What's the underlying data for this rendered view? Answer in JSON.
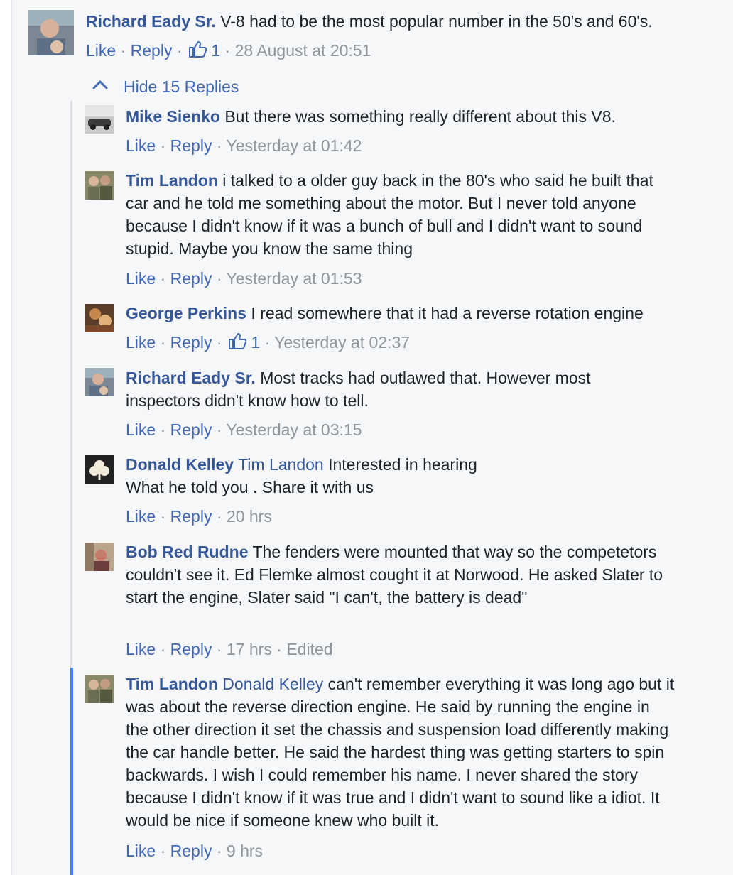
{
  "top_comment": {
    "author": "Richard Eady Sr.",
    "text": "V-8 had to be the most popular number in the 50's and 60's.",
    "like": "Like",
    "reply": "Reply",
    "likes": "1",
    "time": "28 August at 20:51"
  },
  "replies_toggle": {
    "label": "Hide 15 Replies",
    "icon": "chevron-up-icon"
  },
  "replies": [
    {
      "author": "Mike Sienko",
      "mention": "",
      "text": "But there was something really different about this V8.",
      "like": "Like",
      "reply": "Reply",
      "likes": "",
      "time": "Yesterday at 01:42",
      "edited": ""
    },
    {
      "author": "Tim Landon",
      "mention": "",
      "text": "i talked to a older guy back in the 80's who said he built that car and he told me something about the motor. But I never told anyone because I didn't know if it was a bunch of bull and I didn't want to sound stupid. Maybe you know the same thing",
      "like": "Like",
      "reply": "Reply",
      "likes": "",
      "time": "Yesterday at 01:53",
      "edited": ""
    },
    {
      "author": "George Perkins",
      "mention": "",
      "text": "I read somewhere that it had a reverse rotation engine",
      "like": "Like",
      "reply": "Reply",
      "likes": "1",
      "time": "Yesterday at 02:37",
      "edited": ""
    },
    {
      "author": "Richard Eady Sr.",
      "mention": "",
      "text": "Most tracks had outlawed that. However most inspectors didn't know how to tell.",
      "like": "Like",
      "reply": "Reply",
      "likes": "",
      "time": "Yesterday at 03:15",
      "edited": ""
    },
    {
      "author": "Donald Kelley",
      "mention": "Tim Landon",
      "text": "Interested in hearing",
      "text2": "What he told you . Share it with us",
      "like": "Like",
      "reply": "Reply",
      "likes": "",
      "time": "20 hrs",
      "edited": ""
    },
    {
      "author": "Bob Red Rudne",
      "mention": "",
      "text": "The fenders were mounted that way so the competetors couldn't see it. Ed Flemke almost cought it at Norwood. He asked Slater to start the engine, Slater said \"I can't, the battery is dead\"",
      "like": "Like",
      "reply": "Reply",
      "likes": "",
      "time": "17 hrs",
      "edited": "Edited"
    },
    {
      "author": "Tim Landon",
      "mention": "Donald Kelley",
      "text": "can't remember everything it was long ago but it was about the reverse direction engine. He said by running the engine in the other direction it set the chassis and suspension load differently making the car handle better. He said the hardest thing was getting starters to spin backwards. I wish I could remember his name. I never shared the story because I didn't know if it was true and I didn't want to sound like a idiot. It would be nice if someone knew who built it.",
      "like": "Like",
      "reply": "Reply",
      "likes": "",
      "time": "9 hrs",
      "edited": ""
    }
  ],
  "colors": {
    "link": "#365899",
    "action": "#4267b2",
    "meta": "#90949c",
    "active_thread": "#4080ff",
    "background": "#f6f7f9"
  }
}
